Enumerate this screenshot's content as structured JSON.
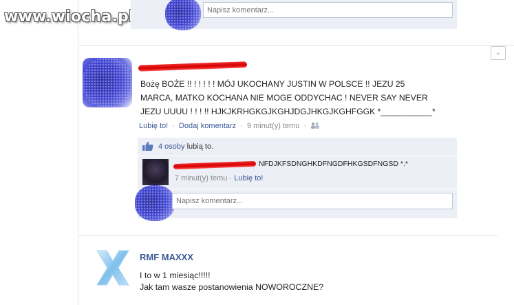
{
  "watermark": {
    "text": "www.wiocha.pl"
  },
  "top_composer": {
    "placeholder": "Napisz komentarz..."
  },
  "post": {
    "text": "Bożę BOŻE !! ! ! ! ! ! MÓJ UKOCHANY JUSTIN W POLSCE !! JEZU 25\nMARCA, MATKO KOCHANA NIE MOGE ODDYCHAC ! NEVER SAY NEVER\nJEZU UUUU ! ! ! !! HJKJKRHGKGJKGHJDGJHKGJKGHFGGK *___________*",
    "like_link": "Lubię to!",
    "comment_link": "Dodaj komentarz",
    "separator": "·",
    "time": "9 minut(y) temu",
    "time_suffix": "·",
    "chevron": "⌄"
  },
  "likes": {
    "count_text": "4 osoby",
    "suffix": "lubią to."
  },
  "comment": {
    "text": "NFDJKFSDNGHKDFNGDFHKGSDFNGSD *.*",
    "time": "7 minut(y) temu",
    "separator": "·",
    "like_link": "Lubię to!"
  },
  "write_comment": {
    "placeholder": "Napisz komentarz..."
  },
  "next_post": {
    "author": "RMF MAXXX",
    "line1": "I to w 1 miesiąc!!!!!",
    "line2": "Jak tam wasze postanowienia NOWOROCZNE?"
  },
  "colors": {
    "link": "#3b5998",
    "comment_bg": "#eceff5",
    "scribble": "#e00000",
    "blur": "#3f44d1"
  }
}
